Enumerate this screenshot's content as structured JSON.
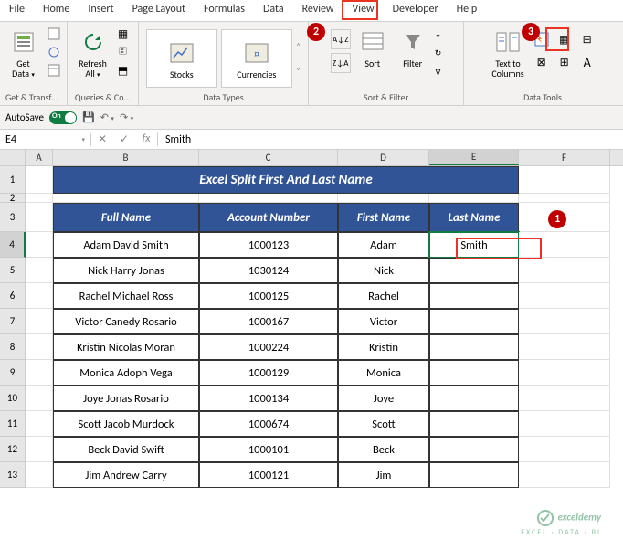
{
  "tabs": [
    "File",
    "Home",
    "Insert",
    "Page Layout",
    "Formulas",
    "Data",
    "Review",
    "View",
    "Developer",
    "Help"
  ],
  "activeTab": "Data",
  "ribbon": {
    "groups": [
      {
        "label": "Get & Transform...",
        "buttons": [
          {
            "name": "get-data",
            "label": "Get\nData"
          }
        ]
      },
      {
        "label": "Queries & Co...",
        "buttons": [
          {
            "name": "refresh-all",
            "label": "Refresh\nAll"
          }
        ]
      },
      {
        "label": "Data Types",
        "buttons": [
          {
            "name": "stocks",
            "label": "Stocks"
          },
          {
            "name": "currencies",
            "label": "Currencies"
          }
        ]
      },
      {
        "label": "Sort & Filter",
        "buttons": [
          {
            "name": "sort",
            "label": "Sort"
          },
          {
            "name": "filter",
            "label": "Filter"
          }
        ]
      },
      {
        "label": "Data Tools",
        "buttons": [
          {
            "name": "text-to-columns",
            "label": "Text to\nColumns"
          },
          {
            "name": "flash-fill",
            "label": ""
          }
        ]
      }
    ]
  },
  "autosave": {
    "label": "AutoSave",
    "state": "On"
  },
  "namebox": "E4",
  "formula": "Smith",
  "columns": [
    "A",
    "B",
    "C",
    "D",
    "E",
    "F"
  ],
  "title": "Excel Split First And Last Name",
  "headers": {
    "b": "Full Name",
    "c": "Account Number",
    "d": "First Name",
    "e": "Last Name"
  },
  "rows": [
    {
      "n": 4,
      "b": "Adam David Smith",
      "c": "1000123",
      "d": "Adam",
      "e": "Smith"
    },
    {
      "n": 5,
      "b": "Nick Harry Jonas",
      "c": "1030124",
      "d": "Nick",
      "e": ""
    },
    {
      "n": 6,
      "b": "Rachel Michael Ross",
      "c": "1000125",
      "d": "Rachel",
      "e": ""
    },
    {
      "n": 7,
      "b": "Victor Canedy Rosario",
      "c": "1000167",
      "d": "Victor",
      "e": ""
    },
    {
      "n": 8,
      "b": "Kristin Nicolas Moran",
      "c": "1000224",
      "d": "Kristin",
      "e": ""
    },
    {
      "n": 9,
      "b": "Monica Adoph Vega",
      "c": "1000129",
      "d": "Monica",
      "e": ""
    },
    {
      "n": 10,
      "b": "Joye Jonas Rosario",
      "c": "1000134",
      "d": "Joye",
      "e": ""
    },
    {
      "n": 11,
      "b": "Scott Jacob Murdock",
      "c": "1000674",
      "d": "Scott",
      "e": ""
    },
    {
      "n": 12,
      "b": "Beck David Swift",
      "c": "1000101",
      "d": "Beck",
      "e": ""
    },
    {
      "n": 13,
      "b": "Jim Andrew Carry",
      "c": "1000121",
      "d": "Jim",
      "e": ""
    }
  ],
  "callouts": {
    "c1": "1",
    "c2": "2",
    "c3": "3"
  },
  "watermark": {
    "main": "exceldemy",
    "sub": "EXCEL · DATA · BI"
  }
}
